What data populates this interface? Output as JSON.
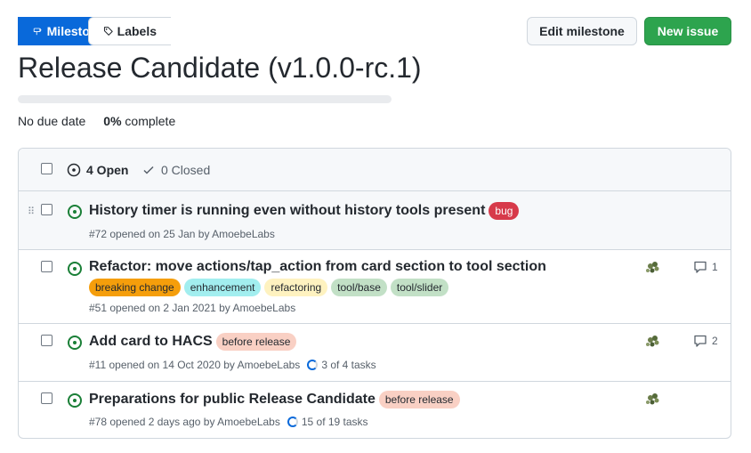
{
  "tabs": {
    "labels": "Labels",
    "milestones": "Milestones"
  },
  "buttons": {
    "edit": "Edit milestone",
    "new_issue": "New issue"
  },
  "milestone": {
    "title": "Release Candidate (v1.0.0-rc.1)",
    "due": "No due date",
    "percent": "0%",
    "complete_label": "complete",
    "progress": 0
  },
  "list_header": {
    "open": "4 Open",
    "closed": "0 Closed"
  },
  "issues": [
    {
      "title": "History timer is running even without history tools present",
      "labels": [
        {
          "name": "bug",
          "bg": "#d73a4a",
          "fg": "#ffffff"
        }
      ],
      "meta": "#72 opened on 25 Jan by AmoebeLabs"
    },
    {
      "title": "Refactor: move actions/tap_action from card section to tool section",
      "labels": [
        {
          "name": "breaking change",
          "bg": "#f59e0b",
          "fg": "#24292f"
        },
        {
          "name": "enhancement",
          "bg": "#a2eeef",
          "fg": "#24292f"
        },
        {
          "name": "refactoring",
          "bg": "#fef2c0",
          "fg": "#24292f"
        },
        {
          "name": "tool/base",
          "bg": "#c2e0c6",
          "fg": "#24292f"
        },
        {
          "name": "tool/slider",
          "bg": "#c2e0c6",
          "fg": "#24292f"
        }
      ],
      "meta": "#51 opened on 2 Jan 2021 by AmoebeLabs",
      "comments": "1"
    },
    {
      "title": "Add card to HACS",
      "labels": [
        {
          "name": "before release",
          "bg": "#f9d0c4",
          "fg": "#24292f"
        }
      ],
      "meta": "#11 opened on 14 Oct 2020 by AmoebeLabs",
      "tasks": "3 of 4 tasks",
      "comments": "2"
    },
    {
      "title": "Preparations for public Release Candidate",
      "labels": [
        {
          "name": "before release",
          "bg": "#f9d0c4",
          "fg": "#24292f"
        }
      ],
      "meta": "#78 opened 2 days ago by AmoebeLabs",
      "tasks": "15 of 19 tasks"
    }
  ]
}
